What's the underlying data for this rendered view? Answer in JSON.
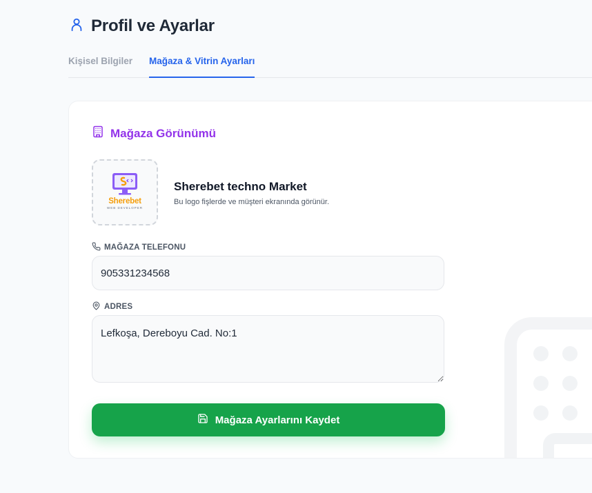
{
  "header": {
    "title": "Profil ve Ayarlar",
    "icon": "user-icon"
  },
  "tabs": [
    {
      "label": "Kişisel Bilgiler",
      "active": false
    },
    {
      "label": "Mağaza & Vitrin Ayarları",
      "active": true
    }
  ],
  "store_section": {
    "title": "Mağaza Görünümü",
    "icon": "building-icon",
    "logo": {
      "name": "Sherebet",
      "subtitle": "WEB DEVELOPER"
    },
    "store_name": "Sherebet techno Market",
    "logo_description": "Bu logo fişlerde ve müşteri ekranında görünür.",
    "phone": {
      "label": "MAĞAZA TELEFONU",
      "icon": "phone-icon",
      "value": "905331234568"
    },
    "address": {
      "label": "ADRES",
      "icon": "map-pin-icon",
      "value": "Lefkoşa, Dereboyu Cad. No:1"
    },
    "save_button": {
      "label": "Mağaza Ayarlarını Kaydet",
      "icon": "save-icon"
    }
  },
  "colors": {
    "primary": "#2563eb",
    "section_accent": "#9333ea",
    "success": "#16a34a"
  }
}
